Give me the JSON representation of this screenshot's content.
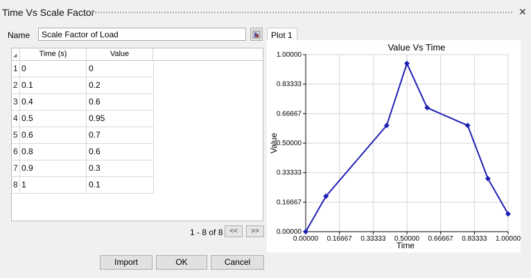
{
  "window": {
    "title": "Time Vs Scale Factor"
  },
  "name_field": {
    "label": "Name",
    "value": "Scale Factor of Load"
  },
  "table": {
    "columns": [
      "Time (s)",
      "Value"
    ],
    "rows": [
      {
        "index": "1",
        "time": "0",
        "value": "0"
      },
      {
        "index": "2",
        "time": "0.1",
        "value": "0.2"
      },
      {
        "index": "3",
        "time": "0.4",
        "value": "0.6"
      },
      {
        "index": "4",
        "time": "0.5",
        "value": "0.95"
      },
      {
        "index": "5",
        "time": "0.6",
        "value": "0.7"
      },
      {
        "index": "6",
        "time": "0.8",
        "value": "0.6"
      },
      {
        "index": "7",
        "time": "0.9",
        "value": "0.3"
      },
      {
        "index": "8",
        "time": "1",
        "value": "0.1"
      }
    ]
  },
  "pager": {
    "text": "1 - 8 of 8",
    "prev_label": "<<",
    "next_label": ">>"
  },
  "tabs": [
    {
      "label": "Plot 1"
    }
  ],
  "buttons": {
    "import": "Import",
    "ok": "OK",
    "cancel": "Cancel"
  },
  "chart_data": {
    "type": "line",
    "title": "Value Vs Time",
    "xlabel": "Time",
    "ylabel": "Value",
    "x": [
      0,
      0.1,
      0.4,
      0.5,
      0.6,
      0.8,
      0.9,
      1.0
    ],
    "series": [
      {
        "values": [
          0,
          0.2,
          0.6,
          0.95,
          0.7,
          0.6,
          0.3,
          0.1
        ],
        "color": "#1f1fb4"
      }
    ],
    "xlim": [
      0,
      1
    ],
    "ylim": [
      0,
      1
    ],
    "xticks": [
      "0.00000",
      "0.16667",
      "0.33333",
      "0.50000",
      "0.66667",
      "0.83333",
      "1.00000"
    ],
    "yticks": [
      "0.00000",
      "0.16667",
      "0.33333",
      "0.50000",
      "0.66667",
      "0.83333",
      "1.00000"
    ],
    "grid": true,
    "marker": "diamond"
  }
}
